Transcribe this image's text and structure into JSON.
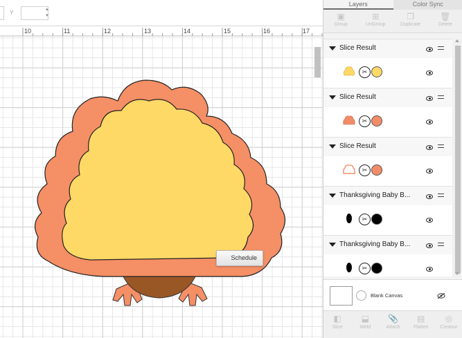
{
  "ruler": {
    "labels": [
      "10",
      "11",
      "12",
      "13",
      "14",
      "15",
      "16",
      "17"
    ]
  },
  "toolbar": {
    "y_label": "Y"
  },
  "canvas": {
    "schedule_label": "Schedule"
  },
  "tabs": [
    {
      "label": "Layers",
      "active": true
    },
    {
      "label": "Color Sync",
      "active": false
    }
  ],
  "top_tools": [
    {
      "label": "Group",
      "icon": "group-icon"
    },
    {
      "label": "UnGroup",
      "icon": "ungroup-icon"
    },
    {
      "label": "Duplicate",
      "icon": "duplicate-icon"
    },
    {
      "label": "Delete",
      "icon": "trash-icon"
    }
  ],
  "layers": [
    {
      "name": "Slice Result",
      "thumb_color": "#ffd966",
      "thumb_kind": "filled",
      "circle_color": "#ffd966"
    },
    {
      "name": "Slice Result",
      "thumb_color": "#f28c68",
      "thumb_kind": "filled",
      "circle_color": "#f28c68"
    },
    {
      "name": "Slice Result",
      "thumb_color": "#f28c68",
      "thumb_kind": "outline",
      "circle_color": "#f28c68"
    },
    {
      "name": "Thanksgiving Baby B...",
      "thumb_color": "#000000",
      "thumb_kind": "oval",
      "circle_color": "#000000"
    },
    {
      "name": "Thanksgiving Baby B...",
      "thumb_color": "#000000",
      "thumb_kind": "oval",
      "circle_color": "#000000"
    }
  ],
  "blank_canvas": {
    "label": "Blank Canvas"
  },
  "bottom_tools": [
    {
      "label": "Slice",
      "icon": "slice-icon"
    },
    {
      "label": "Weld",
      "icon": "weld-icon"
    },
    {
      "label": "Attach",
      "icon": "attach-icon"
    },
    {
      "label": "Flatten",
      "icon": "flatten-icon"
    },
    {
      "label": "Contour",
      "icon": "contour-icon"
    }
  ],
  "colors": {
    "outer_feathers": "#f58f66",
    "inner_feathers": "#ffd966",
    "body": "#9a5726",
    "legs": "#f58f66"
  }
}
